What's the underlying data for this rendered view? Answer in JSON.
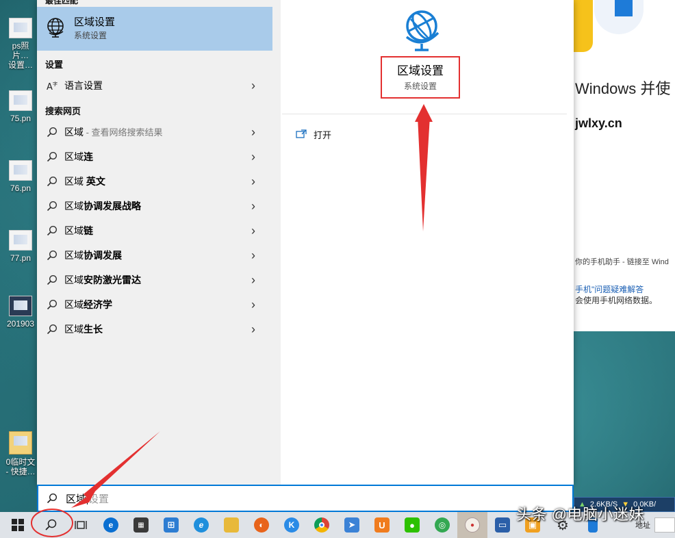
{
  "desktop": {
    "icons": [
      {
        "label": "ps照片…\n设置…"
      },
      {
        "label": "75.pn"
      },
      {
        "label": "76.pn"
      },
      {
        "label": "77.pn"
      },
      {
        "label": "201903"
      },
      {
        "label": "0临时文\n- 快捷…"
      }
    ]
  },
  "background_app": {
    "title": "Windows 并使",
    "url": "jwlxy.cn",
    "line1": "你的手机助手 - 链接至 Wind",
    "link": "手机\"问题疑难解答",
    "line2": "会使用手机网络数据。"
  },
  "net_widget": {
    "up": "2.6KB/S",
    "down": "0.0KB/"
  },
  "search_panel": {
    "best_match_header": "最佳匹配",
    "best_match": {
      "title": "区域设置",
      "subtitle": "系统设置"
    },
    "settings_header": "设置",
    "settings_items": [
      {
        "label": "语言设置"
      }
    ],
    "web_header": "搜索网页",
    "web_items": [
      {
        "prefix": "区域",
        "bold": "",
        "hint": " - 查看网络搜索结果"
      },
      {
        "prefix": "区域",
        "bold": "连",
        "hint": ""
      },
      {
        "prefix": "区域 ",
        "bold": "英文",
        "hint": ""
      },
      {
        "prefix": "区域",
        "bold": "协调发展战略",
        "hint": ""
      },
      {
        "prefix": "区域",
        "bold": "链",
        "hint": ""
      },
      {
        "prefix": "区域",
        "bold": "协调发展",
        "hint": ""
      },
      {
        "prefix": "区域",
        "bold": "安防激光雷达",
        "hint": ""
      },
      {
        "prefix": "区域",
        "bold": "经济学",
        "hint": ""
      },
      {
        "prefix": "区域",
        "bold": "生长",
        "hint": ""
      }
    ],
    "preview": {
      "title": "区域设置",
      "subtitle": "系统设置",
      "open_label": "打开"
    }
  },
  "search_box": {
    "typed": "区域",
    "suggestion": "设置"
  },
  "taskbar": {
    "address_label": "地址",
    "apps": [
      "task-view",
      "edge",
      "calculator",
      "store",
      "internet-explorer",
      "file-explorer",
      "firefox",
      "kugou",
      "chrome",
      "feishu",
      "uc-browser",
      "wechat",
      "360-secure",
      "app-active",
      "remote-desktop",
      "vm-tool",
      "settings",
      "phone"
    ]
  },
  "watermark": "头条 @电脑小迷妹",
  "colors": {
    "highlight": "#a9cbea",
    "accent": "#0078d7",
    "annotation_red": "#e33030"
  }
}
